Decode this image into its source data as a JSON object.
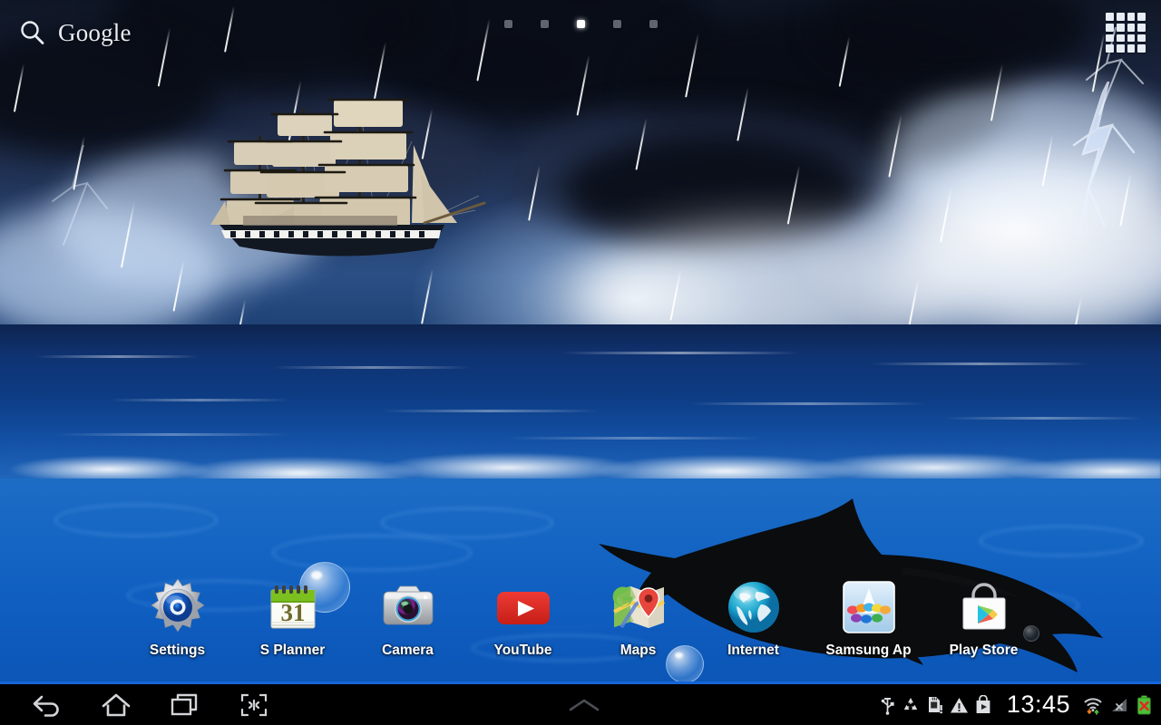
{
  "statusbar": {
    "clock": "13:45",
    "icons": [
      {
        "name": "usb-icon",
        "label": "USB connected"
      },
      {
        "name": "recycle-icon",
        "label": "Recycle"
      },
      {
        "name": "sd-card-warning-icon",
        "label": "SD card"
      },
      {
        "name": "warning-icon",
        "label": "Warning"
      },
      {
        "name": "play-store-update-icon",
        "label": "Play Store"
      },
      {
        "name": "wifi-icon",
        "label": "Wi-Fi"
      },
      {
        "name": "signal-off-icon",
        "label": "No signal"
      },
      {
        "name": "battery-error-icon",
        "label": "Battery"
      }
    ]
  },
  "search_widget": {
    "brand": "Google",
    "icon": "search-icon"
  },
  "apps_button": {
    "icon": "apps-grid-icon",
    "label": "Apps"
  },
  "pages": {
    "count": 5,
    "active_index": 2
  },
  "dock": {
    "apps": [
      {
        "label": "Settings",
        "icon": "settings-gear-icon"
      },
      {
        "label": "S Planner",
        "icon": "calendar-icon",
        "day": "31"
      },
      {
        "label": "Camera",
        "icon": "camera-icon"
      },
      {
        "label": "YouTube",
        "icon": "youtube-icon"
      },
      {
        "label": "Maps",
        "icon": "maps-icon"
      },
      {
        "label": "Internet",
        "icon": "globe-icon"
      },
      {
        "label": "Samsung Ap",
        "icon": "samsung-apps-icon"
      },
      {
        "label": "Play Store",
        "icon": "play-store-icon"
      }
    ]
  },
  "navbar": {
    "buttons": [
      {
        "name": "back-button",
        "icon": "back-arrow-icon"
      },
      {
        "name": "home-button",
        "icon": "home-icon"
      },
      {
        "name": "recents-button",
        "icon": "recent-apps-icon"
      },
      {
        "name": "screenshot-button",
        "icon": "screen-capture-icon"
      }
    ],
    "tray_handle": {
      "name": "mini-apps-handle",
      "icon": "chevron-up-icon"
    }
  },
  "wallpaper": {
    "theme": "Stormy sea with tall ship and shark",
    "elements": [
      "storm-clouds",
      "lightning",
      "rain",
      "tall-ship",
      "ocean",
      "shark",
      "bubbles"
    ],
    "colors": {
      "sky_dark": "#101726",
      "sea_deep": "#0d3c84",
      "sea_under": "#1667c4",
      "accent_blue": "#1565d8"
    }
  }
}
